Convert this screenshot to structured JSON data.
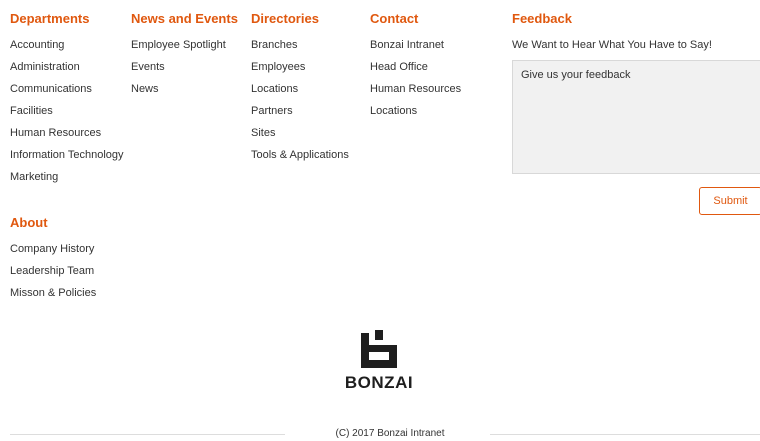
{
  "departments": {
    "title": "Departments",
    "items": [
      "Accounting",
      "Administration",
      "Communications",
      "Facilities",
      "Human Resources",
      "Information Technology",
      "Marketing"
    ]
  },
  "news_events": {
    "title": "News and Events",
    "items": [
      "Employee Spotlight",
      "Events",
      "News"
    ]
  },
  "directories": {
    "title": "Directories",
    "items": [
      "Branches",
      "Employees",
      "Locations",
      "Partners",
      "Sites",
      "Tools & Applications"
    ]
  },
  "contact": {
    "title": "Contact",
    "items": [
      "Bonzai Intranet",
      "Head Office",
      "Human Resources",
      "Locations"
    ]
  },
  "about": {
    "title": "About",
    "items": [
      "Company History",
      "Leadership Team",
      "Misson & Policies"
    ]
  },
  "feedback": {
    "title": "Feedback",
    "prompt": "We Want to Hear What You Have to Say!",
    "placeholder": "Give us your feedback",
    "submit_label": "Submit"
  },
  "footer": {
    "logo_text": "BONZAI",
    "copyright": "(C) 2017 Bonzai Intranet"
  },
  "colors": {
    "accent": "#e0580f",
    "text": "#333333",
    "logo": "#1e1e1e"
  }
}
